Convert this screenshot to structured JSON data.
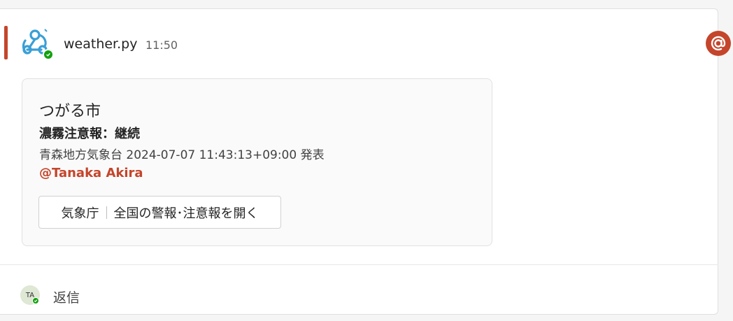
{
  "message": {
    "sender": "weather.py",
    "time": "11:50",
    "bot_icon": "webhook-icon",
    "accent_color": "#c4452b",
    "presence_color": "#13a10e"
  },
  "card": {
    "title": "つがる市",
    "subtitle": "濃霧注意報：継続",
    "meta": "青森地方気象台 2024-07-07 11:43:13+09:00 発表",
    "mention": "@Tanaka Akira",
    "button": {
      "prefix": "気象庁",
      "label": "全国の警報･注意報を開く"
    }
  },
  "reply": {
    "avatar_initials": "TA",
    "label": "返信"
  },
  "mention_badge_icon": "at-icon"
}
